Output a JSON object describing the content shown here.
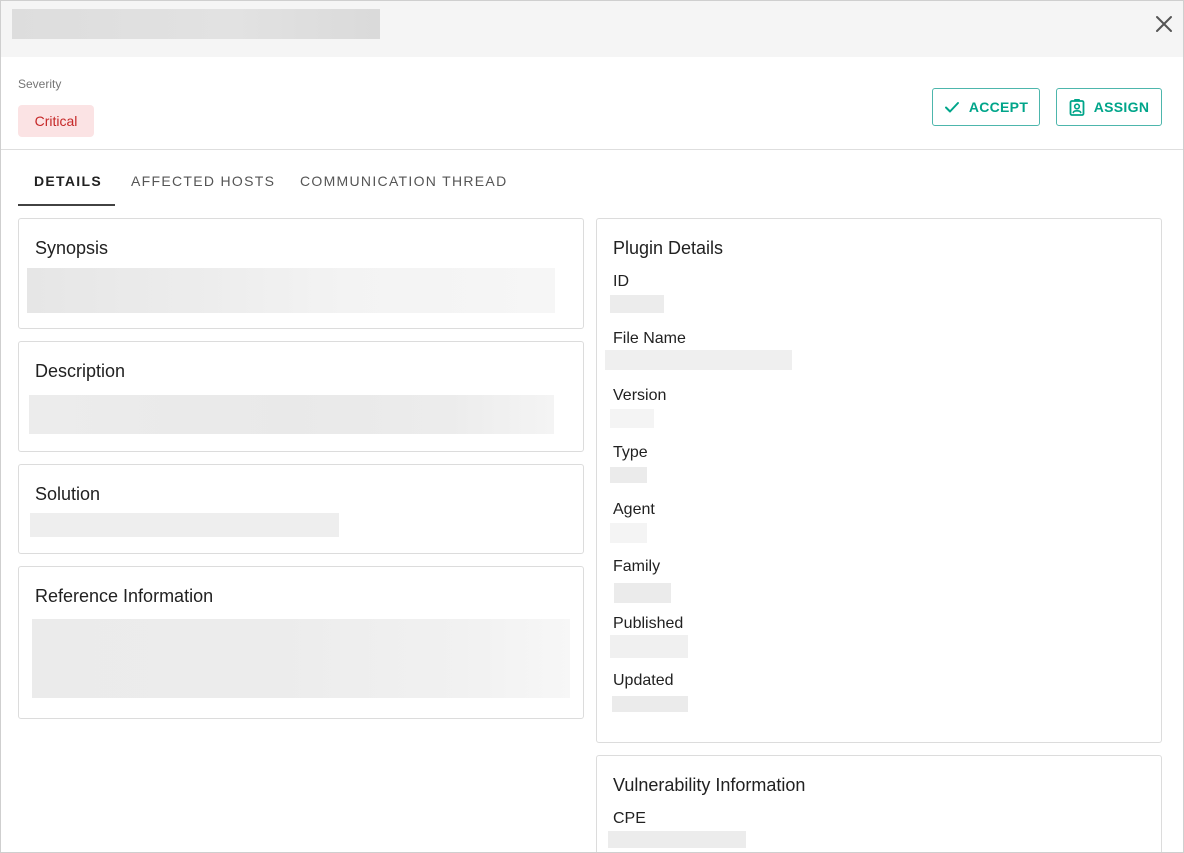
{
  "header": {
    "close_icon": "close-icon"
  },
  "severity": {
    "label": "Severity",
    "value": "Critical",
    "badge_bg": "#fbe3e4",
    "badge_color": "#c62828"
  },
  "actions": {
    "accept_label": "ACCEPT",
    "accept_icon": "check-icon",
    "assign_label": "ASSIGN",
    "assign_icon": "assign-user-icon",
    "accent_color": "#00a58a"
  },
  "tabs": [
    {
      "label": "DETAILS",
      "active": true
    },
    {
      "label": "AFFECTED HOSTS",
      "active": false
    },
    {
      "label": "COMMUNICATION THREAD",
      "active": false
    }
  ],
  "left_cards": {
    "synopsis": {
      "title": "Synopsis"
    },
    "description": {
      "title": "Description"
    },
    "solution": {
      "title": "Solution"
    },
    "reference": {
      "title": "Reference Information"
    }
  },
  "plugin_details": {
    "title": "Plugin Details",
    "fields": [
      {
        "label": "ID"
      },
      {
        "label": "File Name"
      },
      {
        "label": "Version"
      },
      {
        "label": "Type"
      },
      {
        "label": "Agent"
      },
      {
        "label": "Family"
      },
      {
        "label": "Published"
      },
      {
        "label": "Updated"
      }
    ]
  },
  "vulnerability_info": {
    "title": "Vulnerability Information",
    "fields": [
      {
        "label": "CPE"
      }
    ]
  }
}
